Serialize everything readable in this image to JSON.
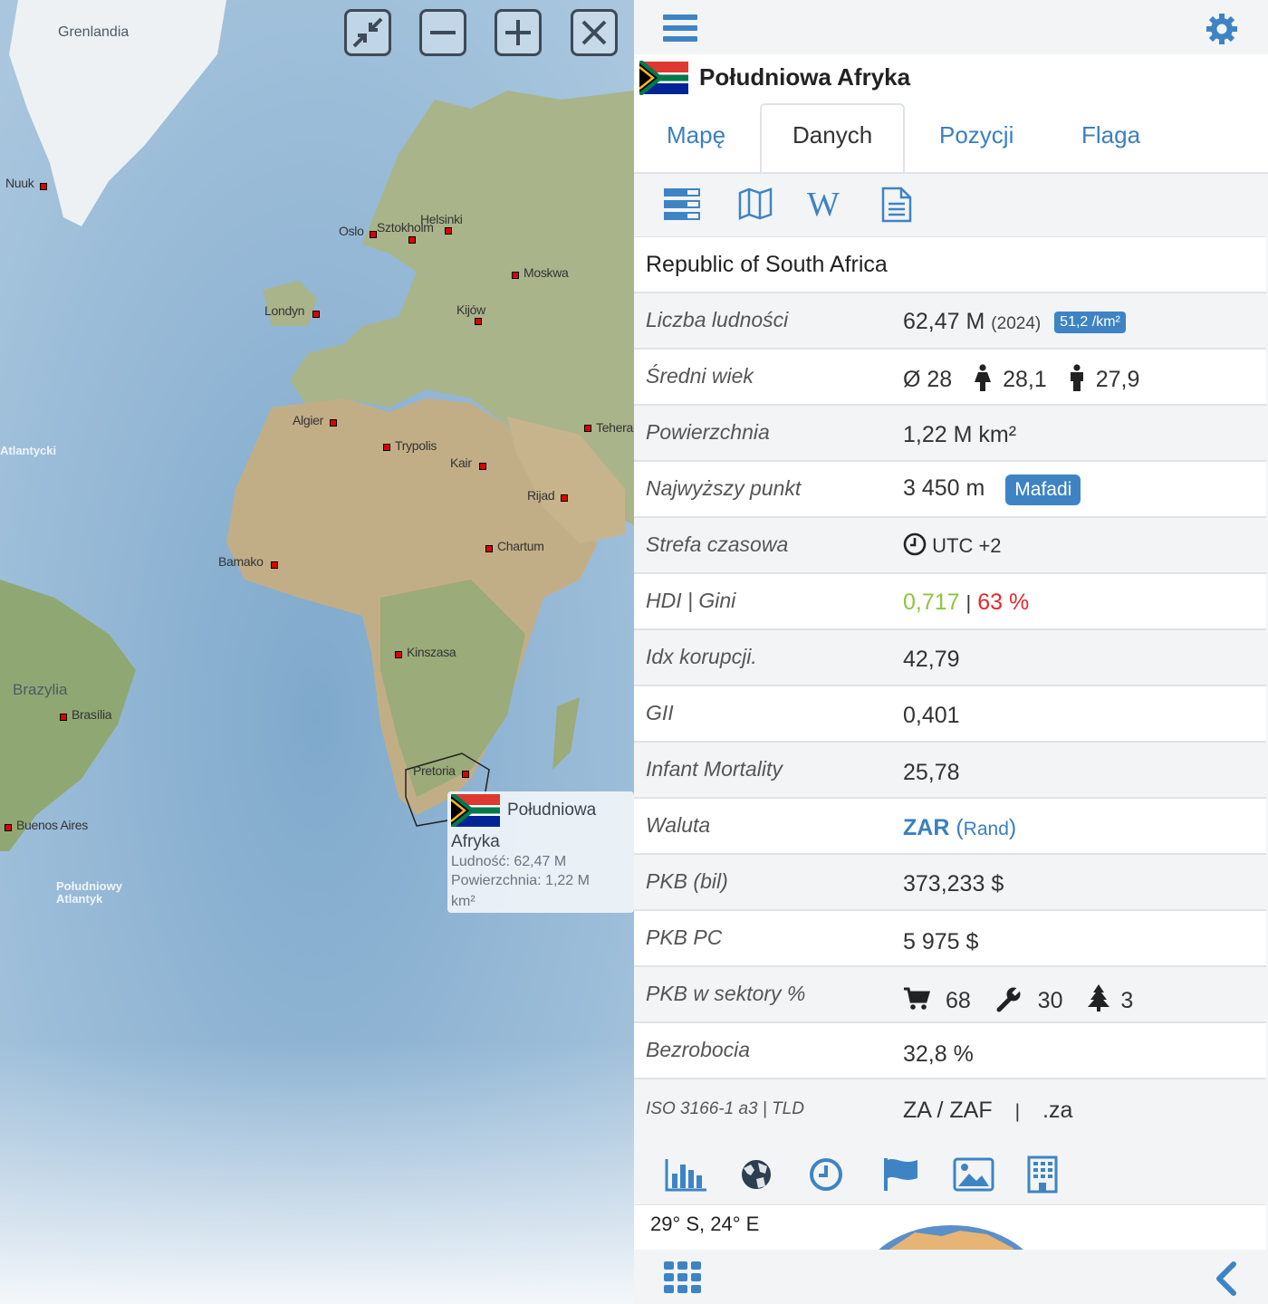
{
  "map": {
    "controls": [
      "fit-screen-icon",
      "zoom-out-icon",
      "zoom-in-icon",
      "close-icon"
    ],
    "labels": {
      "greenland": "Grenlandia",
      "brazil": "Brazylia",
      "atlantic": "Atlantycki",
      "south_atlantic_1": "Południowy",
      "south_atlantic_2": "Atlantyk"
    },
    "cities": [
      "Nuuk",
      "Oslo",
      "Sztokholm",
      "Helsinki",
      "Moskwa",
      "Londyn",
      "Kijów",
      "Algier",
      "Trypolis",
      "Kair",
      "Teheran",
      "Rijad",
      "Chartum",
      "Bamako",
      "Kinszasa",
      "Brasília",
      "Buenos Aires",
      "Pretoria"
    ],
    "tooltip": {
      "name_line1": "Południowa",
      "name_line2": "Afryka",
      "population": "Ludność: 62,47 M",
      "area_1": "Powierzchnia: 1,22 M",
      "area_2": "km²"
    }
  },
  "panel": {
    "title": "Południowa Afryka",
    "tabs": [
      "Mapę",
      "Danych",
      "Pozycji",
      "Flaga"
    ],
    "active_tab": "Danych",
    "official_name": "Republic of South Africa",
    "rows": {
      "population": {
        "label": "Liczba ludności",
        "value": "62,47 M",
        "year": "(2024)",
        "density": "51,2 /km²"
      },
      "median_age": {
        "label": "Średni wiek",
        "avg": "Ø 28",
        "male": "28,1",
        "female": "27,9"
      },
      "area": {
        "label": "Powierzchnia",
        "value": "1,22 M km²"
      },
      "highest": {
        "label": "Najwyższy punkt",
        "value": "3 450 m",
        "peak": "Mafadi"
      },
      "timezone": {
        "label": "Strefa czasowa",
        "value": "UTC +2"
      },
      "hdi": {
        "label": "HDI | Gini",
        "hdi": "0,717",
        "sep": "|",
        "gini": "63 %"
      },
      "corruption": {
        "label": "Idx korupcji.",
        "value": "42,79"
      },
      "gii": {
        "label": "GII",
        "value": "0,401"
      },
      "infant": {
        "label": "Infant Mortality",
        "value": "25,78"
      },
      "currency": {
        "label": "Waluta",
        "code": "ZAR",
        "name_open": "(",
        "name": "Rand",
        "name_close": ")"
      },
      "gdp": {
        "label": "PKB (bil)",
        "value": "373,233 $"
      },
      "gdp_pc": {
        "label": "PKB PC",
        "value": "5 975 $"
      },
      "sectors": {
        "label": "PKB w sektory %",
        "services": "68",
        "industry": "30",
        "agriculture": "3"
      },
      "unemployment": {
        "label": "Bezrobocia",
        "value": "32,8 %"
      },
      "iso": {
        "label": "ISO 3166-1 a3 | TLD",
        "code": "ZA / ZAF",
        "sep": "|",
        "tld": ".za"
      }
    },
    "coords": "29° S, 24° E"
  },
  "colors": {
    "accent": "#3e84c4",
    "hdi_green": "#8dc63f",
    "gini_red": "#e8262a",
    "link_blue": "#3a7fc1"
  }
}
